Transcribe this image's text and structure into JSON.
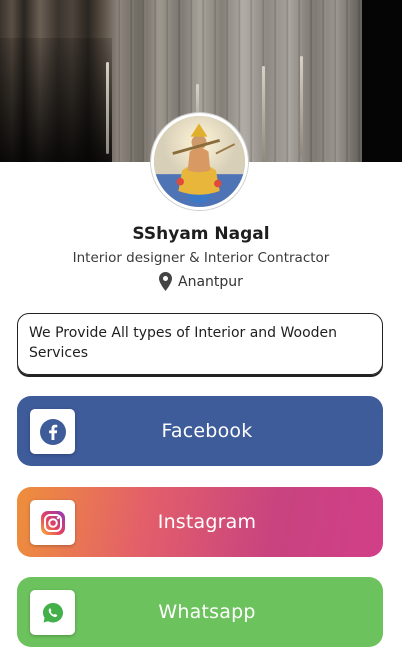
{
  "profile": {
    "name": "SShyam Nagal",
    "role": "Interior designer & Interior Contractor",
    "location": "Anantpur"
  },
  "about": {
    "text": "We Provide All types of Interior and Wooden Services"
  },
  "links": {
    "facebook": {
      "label": "Facebook",
      "icon": "facebook-icon",
      "color": "#3e5b9a"
    },
    "instagram": {
      "label": "Instagram",
      "icon": "instagram-icon",
      "color": "#d23f88"
    },
    "whatsapp": {
      "label": "Whatsapp",
      "icon": "whatsapp-icon",
      "color": "#6cc25d"
    }
  }
}
